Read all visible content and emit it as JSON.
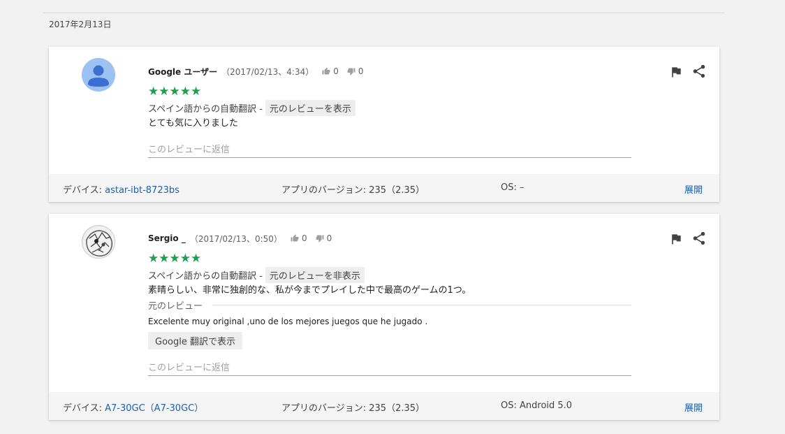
{
  "date_header": "2017年2月13日",
  "colors": {
    "star": "#1f9e4c",
    "link": "#1a5fb4"
  },
  "reviews": [
    {
      "author": "Google ユーザー",
      "timestamp": "（2017/02/13、4:34）",
      "thumbs_up": "0",
      "thumbs_down": "0",
      "rating": 5,
      "stars": "★★★★★",
      "translation_prefix": "スペイン語からの自動翻訳 -",
      "translation_toggle": "元のレビューを表示",
      "text": "とても気に入りました",
      "reply_placeholder": "このレビューに返信",
      "device_label": "デバイス: ",
      "device_value": "astar-ibt-8723bs",
      "app_version": "アプリのバージョン: 235（2.35）",
      "os": "OS: –",
      "expand": "展開"
    },
    {
      "author": "Sergio _",
      "timestamp": "（2017/02/13、0:50）",
      "thumbs_up": "0",
      "thumbs_down": "0",
      "rating": 5,
      "stars": "★★★★★",
      "translation_prefix": "スペイン語からの自動翻訳 -",
      "translation_toggle": "元のレビューを非表示",
      "text": "素晴らしい、非常に独創的な、私が今までプレイした中で最高のゲームの1つ。",
      "original_label": "元のレビュー",
      "original_text": "Excelente muy original ,uno de los mejores juegos que he jugado .",
      "google_translate_button": "Google 翻訳で表示",
      "reply_placeholder": "このレビューに返信",
      "device_label": "デバイス: ",
      "device_value": "A7-30GC（A7-30GC）",
      "app_version": "アプリのバージョン: 235（2.35）",
      "os": "OS: Android 5.0",
      "expand": "展開"
    }
  ]
}
